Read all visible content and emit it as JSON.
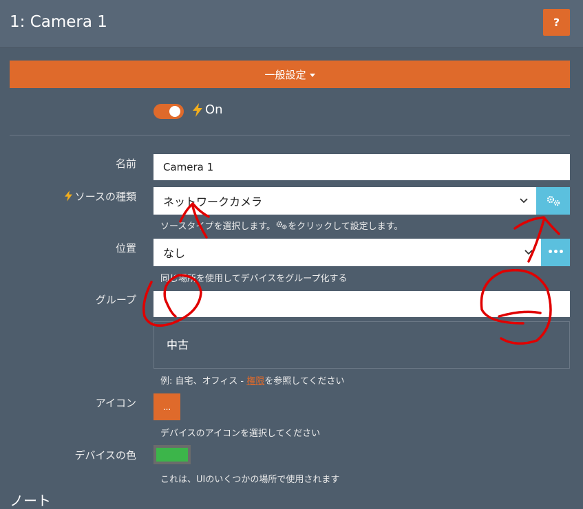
{
  "header": {
    "title": "1: Camera 1",
    "help_label": "?"
  },
  "section": {
    "label": "一般設定"
  },
  "toggle": {
    "state_label": "On"
  },
  "form": {
    "name": {
      "label": "名前",
      "value": "Camera 1"
    },
    "source_type": {
      "label": "ソースの種類",
      "value": "ネットワークカメラ",
      "help_before": "ソースタイプを選択します。",
      "help_after": "をクリックして設定します。"
    },
    "location": {
      "label": "位置",
      "value": "なし",
      "help": "同じ場所を使用してデバイスをグループ化する"
    },
    "group": {
      "label": "グループ",
      "value": "",
      "tag_text": "中古",
      "help_before": "例: 自宅、オフィス - ",
      "help_link": "権限",
      "help_after": "を参照してください"
    },
    "icon": {
      "label": "アイコン",
      "button_label": "...",
      "help": "デバイスのアイコンを選択してください"
    },
    "color": {
      "label": "デバイスの色",
      "value_hex": "#3cb54a",
      "help": "これは、UIのいくつかの場所で使用されます"
    }
  },
  "notes": {
    "heading": "ノート"
  },
  "colors": {
    "accent": "#df6a2b",
    "info": "#5bc0de",
    "background": "#4e5d6c",
    "annotation": "#e00000"
  }
}
